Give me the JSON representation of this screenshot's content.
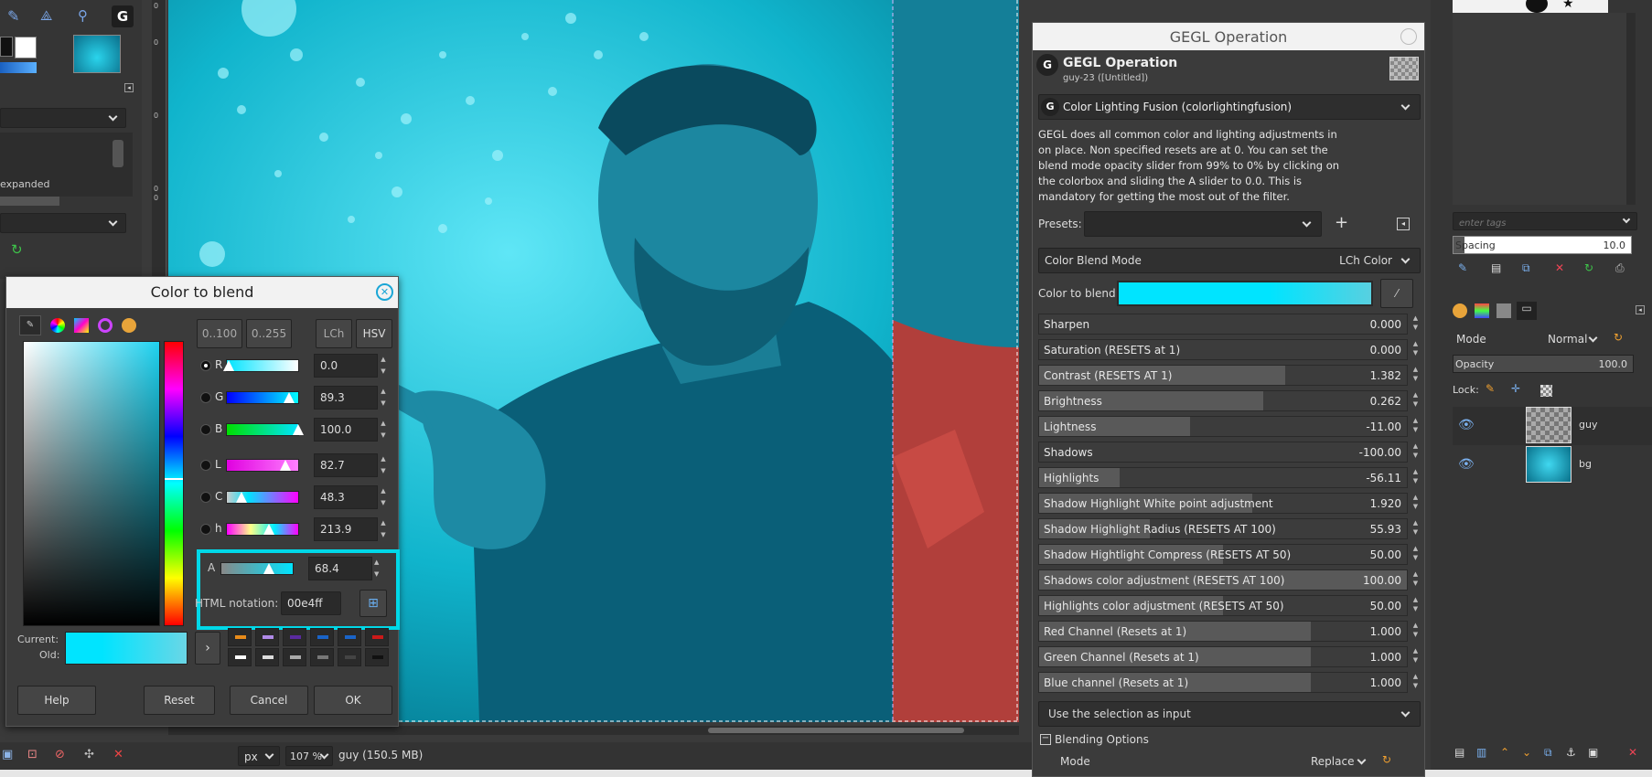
{
  "toolbox": {
    "tools": [
      "paintbrush-icon",
      "path-icon",
      "zoom-icon",
      "gegl-icon"
    ],
    "expanded_label": "expanded"
  },
  "ruler": {
    "marks": [
      "0",
      "0",
      "0",
      "0",
      "0"
    ]
  },
  "statusbar": {
    "unit": "px",
    "zoom": "107 %",
    "image_info": "guy (150.5 MB)"
  },
  "color_dialog": {
    "title": "Color to blend",
    "range_100": "0..100",
    "range_255": "0..255",
    "lch": "LCh",
    "hsv": "HSV",
    "channels": [
      {
        "name": "R",
        "value": "0.0"
      },
      {
        "name": "G",
        "value": "89.3"
      },
      {
        "name": "B",
        "value": "100.0"
      },
      {
        "name": "L",
        "value": "82.7"
      },
      {
        "name": "C",
        "value": "48.3"
      },
      {
        "name": "h",
        "value": "213.9"
      }
    ],
    "alpha": {
      "name": "A",
      "value": "68.4"
    },
    "html_label": "HTML notation:",
    "html_value": "00e4ff",
    "current_label": "Current:",
    "old_label": "Old:",
    "help": "Help",
    "reset": "Reset",
    "cancel": "Cancel",
    "ok": "OK",
    "swatch_colors_row1": [
      "#e88b1a",
      "#b08ae8",
      "#5a2aa0",
      "#1a64c8",
      "#1a64c8",
      "#cc1a1a"
    ],
    "swatch_colors_row2": [
      "#ffffff",
      "#dddddd",
      "#aaaaaa",
      "#777777",
      "#444444",
      "#111111"
    ]
  },
  "gegl": {
    "window_title": "GEGL Operation",
    "header_title": "GEGL Operation",
    "header_sub": "guy-23 ([Untitled])",
    "operation": "Color Lighting Fusion (colorlightingfusion)",
    "description": [
      "GEGL does all common color and lighting adjustments in",
      "on place. Non specified resets are at 0. You can set the",
      "blend mode opacity slider from 99% to 0% by clicking on",
      "the colorbox and sliding the A slider to 0.0. This is",
      "mandatory for getting the most out of the filter."
    ],
    "presets_label": "Presets:",
    "blend_mode_label": "Color Blend Mode",
    "blend_mode_value": "LCh Color",
    "color_to_blend_label": "Color to blend",
    "sliders": [
      {
        "label": "Sharpen",
        "value": "0.000",
        "fill": 0.0
      },
      {
        "label": "Saturation (RESETS at 1)",
        "value": "0.000",
        "fill": 0.0
      },
      {
        "label": "Contrast (RESETS AT 1)",
        "value": "1.382",
        "fill": 0.67
      },
      {
        "label": "Brightness",
        "value": "0.262",
        "fill": 0.61
      },
      {
        "label": "Lightness",
        "value": "-11.00",
        "fill": 0.41
      },
      {
        "label": "Shadows",
        "value": "-100.00",
        "fill": 0.0
      },
      {
        "label": "Highlights",
        "value": "-56.11",
        "fill": 0.22
      },
      {
        "label": "Shadow Highlight White point adjustment",
        "value": "1.920",
        "fill": 0.58
      },
      {
        "label": "Shadow Highlight Radius (RESETS AT 100)",
        "value": "55.93",
        "fill": 0.3
      },
      {
        "label": "Shadow Hightlight Compress (RESETS AT 50)",
        "value": "50.00",
        "fill": 0.5
      },
      {
        "label": "Shadows color adjustment (RESETS AT 100)",
        "value": "100.00",
        "fill": 1.0
      },
      {
        "label": "Highlights color adjustment (RESETS AT 50)",
        "value": "50.00",
        "fill": 0.5
      },
      {
        "label": "Red Channel (Resets at 1)",
        "value": "1.000",
        "fill": 0.74
      },
      {
        "label": "Green Channel (Resets at 1)",
        "value": "1.000",
        "fill": 0.74
      },
      {
        "label": "Blue channel (Resets at 1)",
        "value": "1.000",
        "fill": 0.74
      }
    ],
    "selection_input": "Use the selection as input",
    "blending_options": "Blending Options",
    "mode_label": "Mode",
    "mode_value": "Replace"
  },
  "right_panel": {
    "tags_placeholder": "enter tags",
    "spacing_label": "Spacing",
    "spacing_value": "10.0",
    "mode_label": "Mode",
    "mode_value": "Normal",
    "opacity_label": "Opacity",
    "opacity_value": "100.0",
    "lock_label": "Lock:",
    "layers": [
      {
        "name": "guy"
      },
      {
        "name": "bg"
      }
    ]
  },
  "colors": {
    "accent": "#00e4ff",
    "highlight_border": "#00d8e8"
  }
}
